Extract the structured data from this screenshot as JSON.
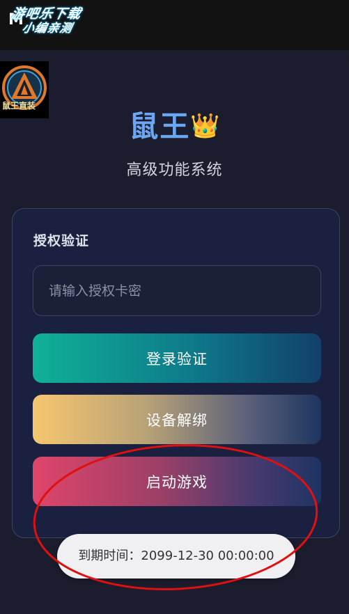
{
  "statusbar": {
    "indicator": "M"
  },
  "watermark": {
    "line1": "游吧乐下载",
    "line2": "小编亲测"
  },
  "app_logo": {
    "text": "鼠王直装"
  },
  "header": {
    "title": "鼠王",
    "crown_icon": "👑",
    "subtitle": "高级功能系统"
  },
  "auth_card": {
    "title": "授权验证",
    "input_placeholder": "请输入授权卡密",
    "input_value": ""
  },
  "buttons": {
    "login": "登录验证",
    "unbind": "设备解绑",
    "launch": "启动游戏"
  },
  "toast": {
    "text": "到期时间：2099-12-30 00:00:00"
  },
  "colors": {
    "title": "#6ba6f2",
    "login_start": "#10b196",
    "unbind_start": "#f6c66f",
    "launch_start": "#e0456a",
    "annotation": "#e01010"
  }
}
